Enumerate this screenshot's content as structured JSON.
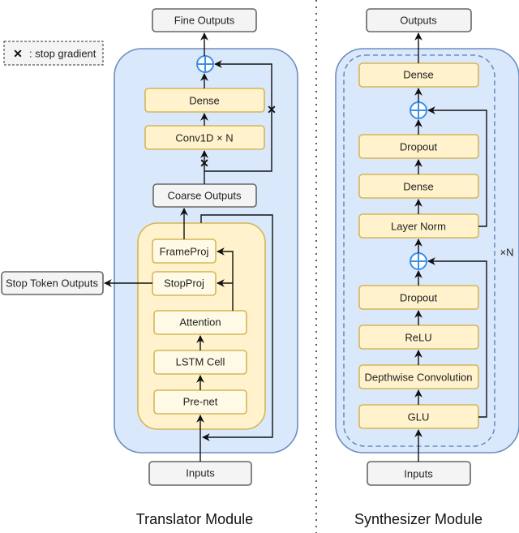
{
  "legend": {
    "symbol": "✕",
    "text": ": stop gradient"
  },
  "translator": {
    "title": "Translator Module",
    "fine_outputs": "Fine Outputs",
    "dense": "Dense",
    "conv": "Conv1D × N",
    "coarse_outputs": "Coarse Outputs",
    "frameproj": "FrameProj",
    "stopproj": "StopProj",
    "attention": "Attention",
    "lstm": "LSTM Cell",
    "prenet": "Pre-net",
    "inputs": "Inputs",
    "stop_token_outputs": "Stop Token Outputs",
    "stop_mark": "✕"
  },
  "synthesizer": {
    "title": "Synthesizer Module",
    "outputs": "Outputs",
    "dense_top": "Dense",
    "dropout_top": "Dropout",
    "dense_mid": "Dense",
    "layer_norm": "Layer Norm",
    "dropout_bottom": "Dropout",
    "relu": "ReLU",
    "depthwise": "Depthwise Convolution",
    "glu": "GLU",
    "inputs": "Inputs",
    "repeat": "×N"
  }
}
